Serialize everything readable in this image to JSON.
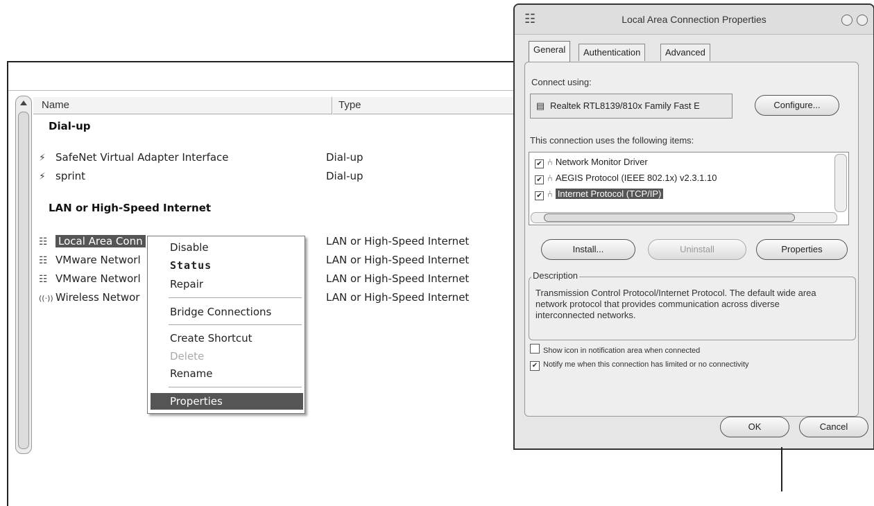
{
  "explorer": {
    "columns": {
      "name": "Name",
      "type": "Type"
    },
    "groups": [
      {
        "title": "Dial-up",
        "rows": [
          {
            "name": "SafeNet Virtual Adapter Interface",
            "type": "Dial-up",
            "icon": "dialup-icon"
          },
          {
            "name": "sprint",
            "type": "Dial-up",
            "icon": "dialup-icon"
          }
        ]
      },
      {
        "title": "LAN or High-Speed Internet",
        "rows": [
          {
            "name": "Local Area Conn",
            "type": "LAN or High-Speed Internet",
            "icon": "lan-icon"
          },
          {
            "name": "VMware Networl",
            "type": "LAN or High-Speed Internet",
            "icon": "lan-icon"
          },
          {
            "name": "VMware Networl",
            "type": "LAN or High-Speed Internet",
            "icon": "lan-icon"
          },
          {
            "name": "Wireless Networ",
            "type": "LAN or High-Speed Internet",
            "icon": "wireless-icon"
          }
        ]
      }
    ]
  },
  "context_menu": {
    "items": [
      "Disable",
      "Status",
      "Repair",
      "Bridge Connections",
      "Create Shortcut",
      "Delete",
      "Rename",
      "Properties"
    ]
  },
  "dialog": {
    "title": "Local Area Connection Properties",
    "tabs": [
      "General",
      "Authentication",
      "Advanced"
    ],
    "connect_using_label": "Connect using:",
    "adapter": "Realtek RTL8139/810x Family Fast E",
    "configure_button": "Configure...",
    "items_label": "This connection uses the following items:",
    "items": [
      {
        "label": "Network Monitor Driver",
        "checked": true
      },
      {
        "label": "AEGIS Protocol (IEEE 802.1x) v2.3.1.10",
        "checked": true
      },
      {
        "label": "Internet Protocol (TCP/IP)",
        "checked": true
      }
    ],
    "install_button": "Install...",
    "uninstall_button": "Uninstall",
    "properties_button": "Properties",
    "description_label": "Description",
    "description_text": "Transmission Control Protocol/Internet Protocol. The default wide area network protocol that provides communication across diverse interconnected networks.",
    "show_icon_label": "Show icon in notification area when connected",
    "notify_label": "Notify me when this connection has limited or no connectivity",
    "show_icon_checked": false,
    "notify_checked": true,
    "ok_button": "OK",
    "cancel_button": "Cancel"
  }
}
